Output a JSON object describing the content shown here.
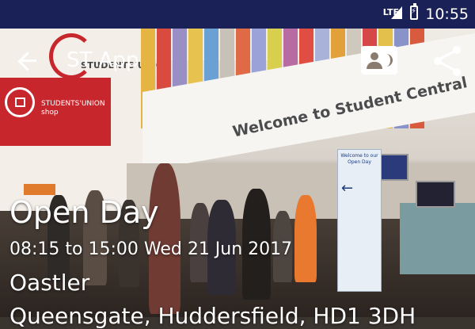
{
  "status_bar": {
    "network": "LTE",
    "time": "10:55",
    "background": "#1a2157"
  },
  "app_bar": {
    "title": "ST App",
    "icons": [
      "back-arrow-icon",
      "contact-card-icon",
      "share-icon"
    ]
  },
  "hero_image": {
    "signs": {
      "welcome": "Welcome to Student Central",
      "students_union": "STUDENTS'UNION",
      "shop": "STUDENTS'UNION shop",
      "open_day_stand": "Welcome to our Open Day"
    }
  },
  "event": {
    "title": "Open Day",
    "datetime": "08:15 to 15:00 Wed 21 Jun 2017",
    "venue": "Oastler",
    "address": "Queensgate, Huddersfield, HD1 3DH"
  }
}
